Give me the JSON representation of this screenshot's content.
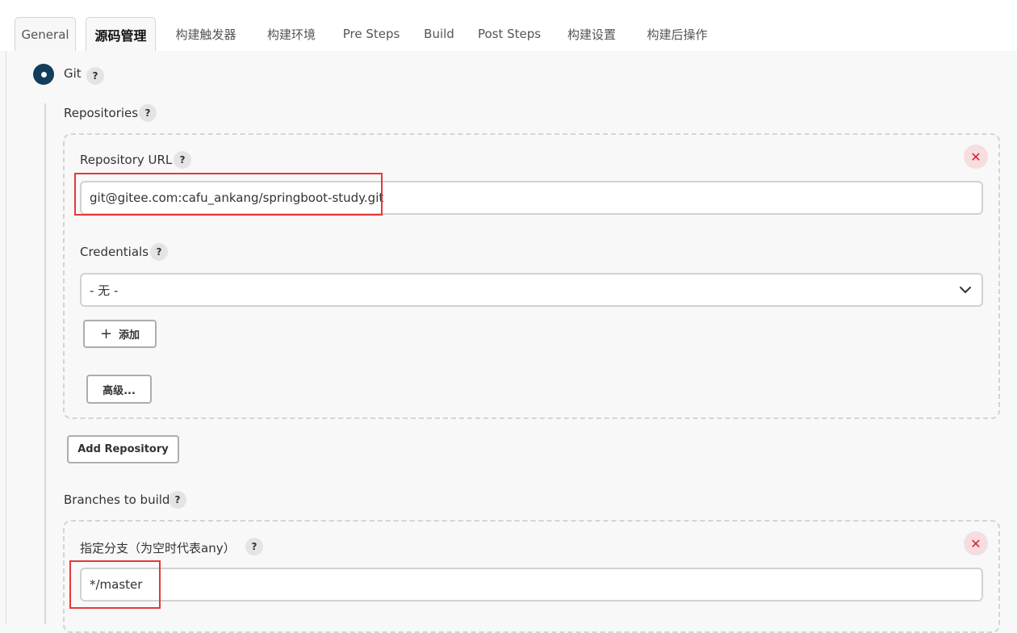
{
  "tabs": [
    "General",
    "源码管理",
    "构建触发器",
    "构建环境",
    "Pre Steps",
    "Build",
    "Post Steps",
    "构建设置",
    "构建后操作"
  ],
  "scm": {
    "option_label": "Git",
    "help_symbol": "?",
    "remove_symbol": "✕",
    "repositories": {
      "label": "Repositories",
      "url_label": "Repository URL",
      "url_value": "git@gitee.com:cafu_ankang/springboot-study.git",
      "credentials_label": "Credentials",
      "credentials_value": "- 无 -",
      "add_button": "添加",
      "add_symbol": "+",
      "advanced_button": "高级...",
      "add_repository_button": "Add Repository"
    },
    "branches": {
      "label": "Branches to build",
      "specifier_label": "指定分支（为空时代表any）",
      "specifier_value": "*/master"
    }
  },
  "colors": {
    "radio_selected": "#123d5c",
    "highlight_box": "#e5383b",
    "remove_icon": "#d3213a"
  }
}
